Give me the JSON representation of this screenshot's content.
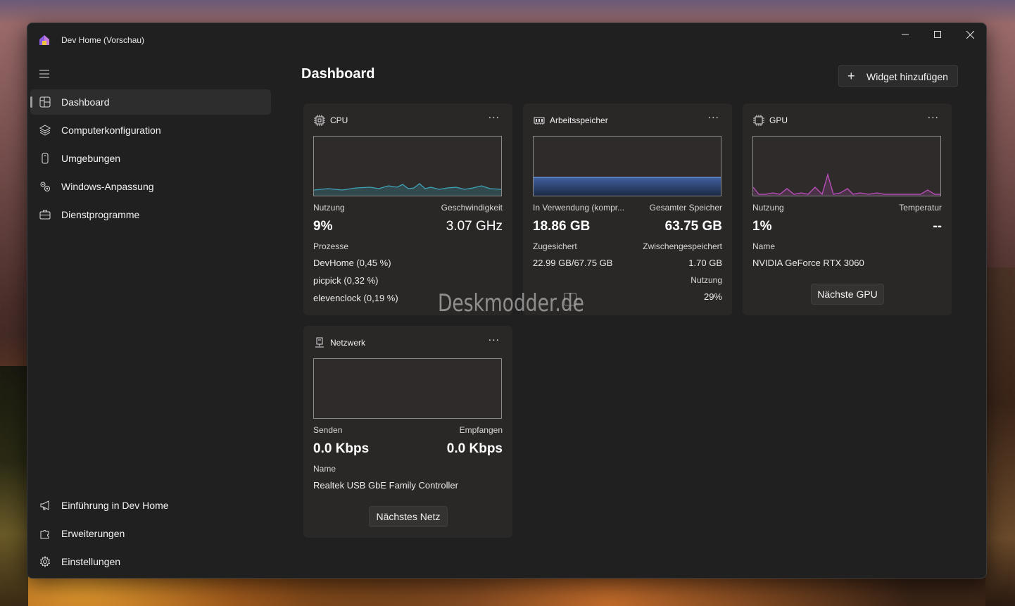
{
  "window": {
    "title": "Dev Home (Vorschau)"
  },
  "sidebar": {
    "items": [
      {
        "label": "Dashboard",
        "icon": "dashboard-icon",
        "active": true
      },
      {
        "label": "Computerkonfiguration",
        "icon": "layers-icon"
      },
      {
        "label": "Umgebungen",
        "icon": "device-icon"
      },
      {
        "label": "Windows-Anpassung",
        "icon": "gears-icon"
      },
      {
        "label": "Dienstprogramme",
        "icon": "toolbox-icon"
      }
    ],
    "footer": [
      {
        "label": "Einführung in Dev Home",
        "icon": "megaphone-icon"
      },
      {
        "label": "Erweiterungen",
        "icon": "puzzle-icon"
      },
      {
        "label": "Einstellungen",
        "icon": "gear-icon"
      }
    ]
  },
  "main": {
    "title": "Dashboard",
    "add_widget_label": "Widget hinzufügen"
  },
  "widgets": {
    "cpu": {
      "title": "CPU",
      "menu": "...",
      "usage_label": "Nutzung",
      "usage": "9%",
      "speed_label": "Geschwindigkeit",
      "speed": "3.07 GHz",
      "processes_label": "Prozesse",
      "processes": [
        "DevHome (0,45 %)",
        "picpick (0,32 %)",
        "elevenclock (0,19 %)"
      ],
      "chart_color": "#3fa3b8"
    },
    "memory": {
      "title": "Arbeitsspeicher",
      "menu": "...",
      "in_use_label": "In Verwendung (kompr...",
      "in_use": "18.86 GB",
      "total_label": "Gesamter Speicher",
      "total": "63.75 GB",
      "committed_label": "Zugesichert",
      "committed": "22.99 GB/67.75 GB",
      "cached_label": "Zwischengespeichert",
      "cached": "1.70 GB",
      "usage_label": "Nutzung",
      "usage": "29%",
      "chart_color": "#4a78c0"
    },
    "gpu": {
      "title": "GPU",
      "menu": "...",
      "usage_label": "Nutzung",
      "usage": "1%",
      "temp_label": "Temperatur",
      "temp": "--",
      "name_label": "Name",
      "name": "NVIDIA GeForce RTX 3060",
      "next_label": "Nächste GPU",
      "chart_color": "#c050c0"
    },
    "network": {
      "title": "Netzwerk",
      "menu": "...",
      "send_label": "Senden",
      "send": "0.0 Kbps",
      "recv_label": "Empfangen",
      "recv": "0.0 Kbps",
      "name_label": "Name",
      "name": "Realtek USB GbE Family Controller",
      "next_label": "Nächstes Netz"
    }
  },
  "watermark": "Deskmodder.de"
}
